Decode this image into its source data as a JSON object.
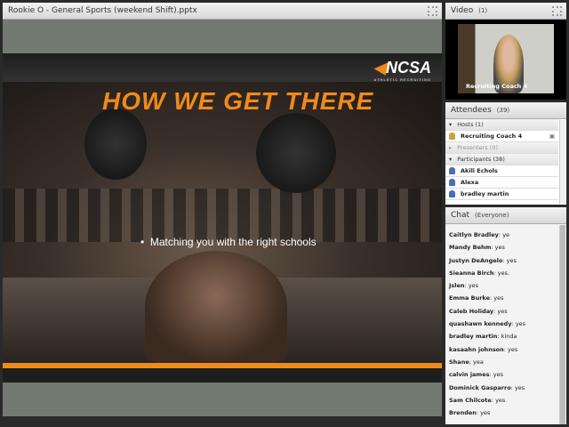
{
  "share": {
    "title": "Rookie O - General Sports  (weekend Shift).pptx",
    "slide": {
      "logo": "NCSA",
      "logo_sub": "ATHLETIC RECRUITING",
      "title": "HOW WE GET THERE",
      "bullet": "Matching you with the right schools"
    }
  },
  "video": {
    "title": "Video",
    "count": "(1)",
    "label": "Recruiting Coach 4"
  },
  "attendees": {
    "title": "Attendees",
    "count": "(39)",
    "hosts": "Hosts (1)",
    "host_name": "Recruiting Coach 4",
    "presenters": "Presenters (0)",
    "participants": "Participants (38)",
    "participant_names": [
      "Akili Echols",
      "Alexa",
      "bradley martin"
    ]
  },
  "chat": {
    "title": "Chat",
    "scope": "(Everyone)",
    "messages": [
      {
        "name": "Caitlyn Bradley",
        "text": "ye"
      },
      {
        "name": "Mandy Behm",
        "text": "yes"
      },
      {
        "name": "Justyn DeAngelo",
        "text": "yes"
      },
      {
        "name": "Sieanna Birch",
        "text": "yes."
      },
      {
        "name": "Jslen",
        "text": "yes"
      },
      {
        "name": "Emma Burke",
        "text": "yes"
      },
      {
        "name": "Caleb Holiday",
        "text": "yes"
      },
      {
        "name": "quashawn kennedy",
        "text": "yes"
      },
      {
        "name": "bradley martin",
        "text": "kinda"
      },
      {
        "name": "kasaahn johnson",
        "text": "yes"
      },
      {
        "name": "Shane",
        "text": "yea"
      },
      {
        "name": "calvin james",
        "text": "yes"
      },
      {
        "name": "Dominick Gasparro",
        "text": "yes"
      },
      {
        "name": "Sam Chilcote",
        "text": "yes"
      },
      {
        "name": "Brenden",
        "text": "yes"
      }
    ]
  },
  "colors": {
    "accent": "#f08a1c"
  }
}
